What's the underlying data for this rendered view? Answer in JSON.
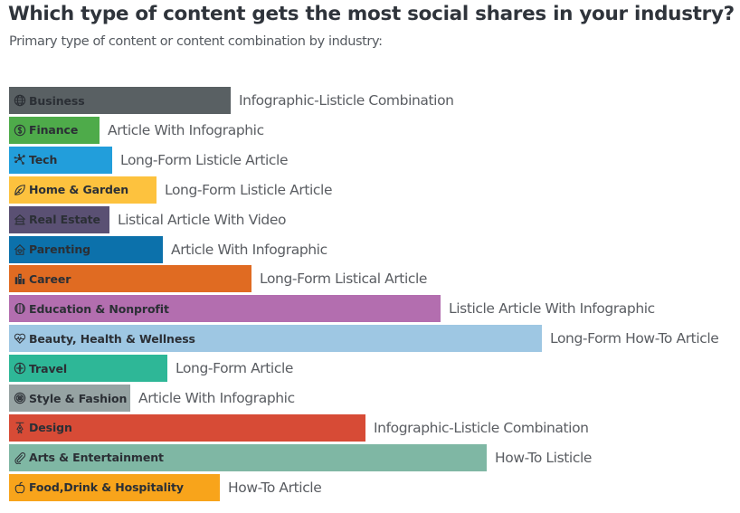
{
  "header": {
    "title": "Which type of content gets the most social shares in your industry?",
    "subtitle": "Primary type of content or content combination by industry:"
  },
  "chart_data": {
    "type": "bar",
    "orientation": "horizontal",
    "title": "Which type of content gets the most social shares in your industry?",
    "subtitle": "Primary type of content or content combination by industry:",
    "xlabel": "",
    "ylabel": "",
    "value_note": "Bar lengths are unlabeled; values are relative lengths estimated as percent of the longest bar",
    "xlim": [
      0,
      100
    ],
    "grid": false,
    "legend": "none",
    "categories": [
      "Business",
      "Finance",
      "Tech",
      "Home & Garden",
      "Real Estate",
      "Parenting",
      "Career",
      "Education & Nonprofit",
      "Beauty, Health & Wellness",
      "Travel",
      "Style & Fashion",
      "Design",
      "Arts & Entertainment",
      "Food,Drink & Hospitality"
    ],
    "values": [
      41.6,
      17.0,
      19.4,
      27.7,
      18.8,
      28.9,
      45.5,
      81.0,
      100,
      29.7,
      22.8,
      66.9,
      89.6,
      39.6
    ],
    "bars": [
      {
        "industry": "Business",
        "icon": "globe-icon",
        "content_type": "Infographic-Listicle Combination",
        "value": 41.6,
        "color": "#596063"
      },
      {
        "industry": "Finance",
        "icon": "dollar-coin-icon",
        "content_type": "Article With Infographic",
        "value": 17.0,
        "color": "#4eab4a"
      },
      {
        "industry": "Tech",
        "icon": "network-nodes-icon",
        "content_type": "Long-Form Listicle Article",
        "value": 19.4,
        "color": "#229edb"
      },
      {
        "industry": "Home & Garden",
        "icon": "leaf-icon",
        "content_type": "Long-Form Listicle Article",
        "value": 27.7,
        "color": "#fdc23e"
      },
      {
        "industry": "Real Estate",
        "icon": "house-icon",
        "content_type": "Listical Article With Video",
        "value": 18.8,
        "color": "#5a5073"
      },
      {
        "industry": "Parenting",
        "icon": "home-heart-icon",
        "content_type": "Article With Infographic",
        "value": 28.9,
        "color": "#0c71ab"
      },
      {
        "industry": "Career",
        "icon": "buildings-icon",
        "content_type": "Long-Form Listical Article",
        "value": 45.5,
        "color": "#e06b22"
      },
      {
        "industry": "Education & Nonprofit",
        "icon": "brain-icon",
        "content_type": "Listicle Article With Infographic",
        "value": 81.0,
        "color": "#b36eaf"
      },
      {
        "industry": "Beauty, Health & Wellness",
        "icon": "heartbeat-icon",
        "content_type": "Long-Form How-To Article",
        "value": 100,
        "color": "#9ec7e3"
      },
      {
        "industry": "Travel",
        "icon": "compass-icon",
        "content_type": "Long-Form Article",
        "value": 29.7,
        "color": "#2eb797"
      },
      {
        "industry": "Style & Fashion",
        "icon": "button-icon",
        "content_type": "Article With Infographic",
        "value": 22.8,
        "color": "#96a3a3"
      },
      {
        "industry": "Design",
        "icon": "pen-nib-icon",
        "content_type": "Infographic-Listicle Combination",
        "value": 66.9,
        "color": "#d74b36"
      },
      {
        "industry": "Arts & Entertainment",
        "icon": "paperclip-icon",
        "content_type": "How-To Listicle",
        "value": 89.6,
        "color": "#7fb7a4"
      },
      {
        "industry": "Food,Drink & Hospitality",
        "icon": "apple-icon",
        "content_type": "How-To Article",
        "value": 39.6,
        "color": "#f8a41b"
      }
    ]
  }
}
